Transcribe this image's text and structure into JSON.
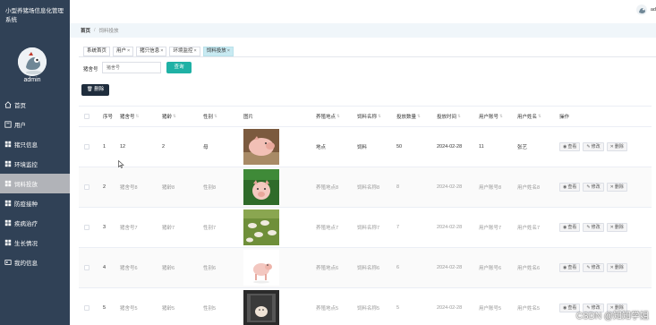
{
  "app": {
    "title": "小型养猪场信息化管理系统",
    "username": "admin",
    "top_user": "ad"
  },
  "sidebar": {
    "items": [
      {
        "label": "首页",
        "icon": "home-icon"
      },
      {
        "label": "用户",
        "icon": "user-icon"
      },
      {
        "label": "猪只信息",
        "icon": "grid-icon"
      },
      {
        "label": "环境监控",
        "icon": "grid-icon"
      },
      {
        "label": "饲料投放",
        "icon": "grid-icon",
        "active": true
      },
      {
        "label": "防疫接种",
        "icon": "grid-icon"
      },
      {
        "label": "疾病治疗",
        "icon": "grid-icon"
      },
      {
        "label": "生长情况",
        "icon": "grid-icon"
      },
      {
        "label": "我的信息",
        "icon": "card-icon"
      }
    ]
  },
  "breadcrumb": {
    "home": "首页",
    "separator": "/",
    "current": "饲料投放"
  },
  "tabs": [
    {
      "label": "系统首页",
      "closable": false
    },
    {
      "label": "用户",
      "closable": true
    },
    {
      "label": "猪只信息",
      "closable": true
    },
    {
      "label": "环境监控",
      "closable": true
    },
    {
      "label": "饲料投放",
      "closable": true,
      "active": true
    }
  ],
  "search": {
    "label": "猪舍号",
    "placeholder": "猪舍号",
    "button": "查询"
  },
  "toolbar": {
    "delete_label": "删除"
  },
  "table": {
    "columns": [
      "序号",
      "猪舍号",
      "猪龄",
      "性别",
      "图片",
      "养殖地点",
      "饲料名称",
      "投放数量",
      "投放时间",
      "用户账号",
      "用户姓名",
      "操作"
    ],
    "rows": [
      {
        "index": "1",
        "pen": "12",
        "age": "2",
        "gender": "母",
        "location": "地点",
        "feed": "饲料",
        "qty": "50",
        "time": "2024-02-28",
        "account": "11",
        "name": "张艺"
      },
      {
        "index": "2",
        "pen": "猪舍号8",
        "age": "猪龄8",
        "gender": "性别8",
        "location": "养殖地点8",
        "feed": "饲料名称8",
        "qty": "8",
        "time": "2024-02-28",
        "account": "用户账号8",
        "name": "用户姓名8"
      },
      {
        "index": "3",
        "pen": "猪舍号7",
        "age": "猪龄7",
        "gender": "性别7",
        "location": "养殖地点7",
        "feed": "饲料名称7",
        "qty": "7",
        "time": "2024-02-28",
        "account": "用户账号7",
        "name": "用户姓名7"
      },
      {
        "index": "4",
        "pen": "猪舍号6",
        "age": "猪龄6",
        "gender": "性别6",
        "location": "养殖地点6",
        "feed": "饲料名称6",
        "qty": "6",
        "time": "2024-02-28",
        "account": "用户账号6",
        "name": "用户姓名6"
      },
      {
        "index": "5",
        "pen": "猪舍号5",
        "age": "猪龄5",
        "gender": "性别5",
        "location": "养殖地点5",
        "feed": "饲料名称5",
        "qty": "5",
        "time": "2024-02-28",
        "account": "用户账号5",
        "name": "用户姓名5"
      }
    ],
    "actions": {
      "view": "查看",
      "edit": "修改",
      "delete": "删除"
    }
  },
  "watermark": "CSDN @知知学姐",
  "colors": {
    "sidebar_bg": "#304156",
    "accent": "#1fb1a5",
    "active_tab": "#c8eaf2"
  }
}
